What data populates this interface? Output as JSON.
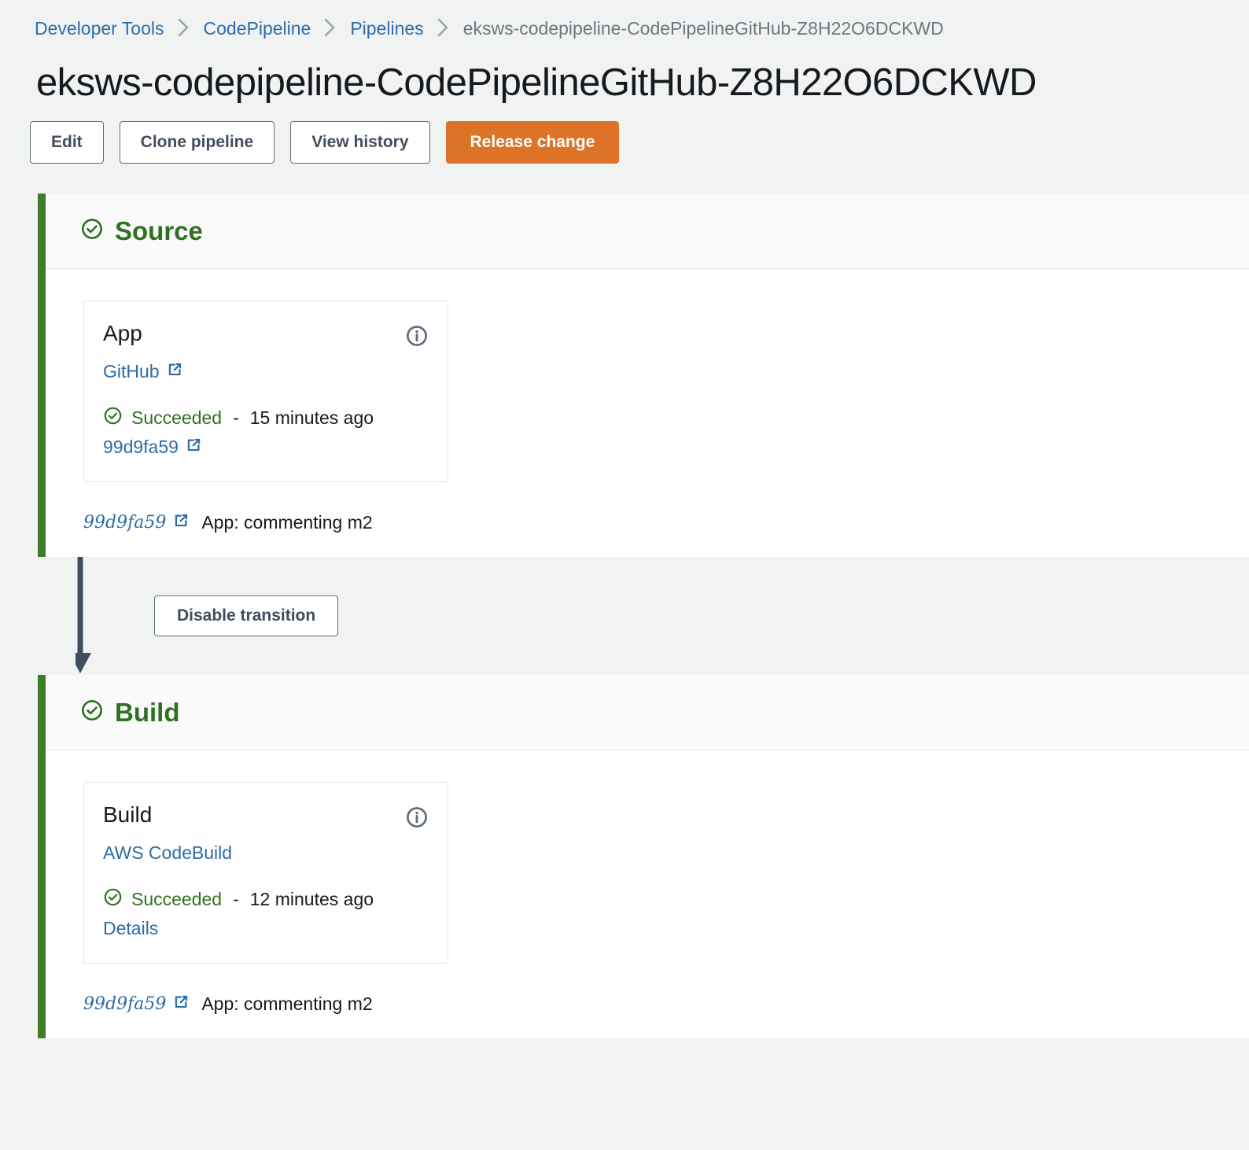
{
  "breadcrumb": {
    "items": [
      {
        "label": "Developer Tools",
        "type": "link"
      },
      {
        "label": "CodePipeline",
        "type": "link"
      },
      {
        "label": "Pipelines",
        "type": "link"
      },
      {
        "label": "eksws-codepipeline-CodePipelineGitHub-Z8H22O6DCKWD",
        "type": "current"
      }
    ],
    "separator_icon": "chevron-right-icon"
  },
  "page": {
    "title": "eksws-codepipeline-CodePipelineGitHub-Z8H22O6DCKWD"
  },
  "toolbar": {
    "edit_label": "Edit",
    "clone_label": "Clone pipeline",
    "history_label": "View history",
    "release_label": "Release change",
    "primary_color": "#dd7326"
  },
  "colors": {
    "success_green": "#2f7122",
    "stage_bar_green": "#3e7d28",
    "link_blue": "#2d6ca8",
    "slate": "#5f6b7a",
    "page_bg": "#f1f3f3"
  },
  "stages": [
    {
      "name": "Source",
      "status_icon": "check-circle-icon",
      "action": {
        "name": "App",
        "info_icon": "info-icon",
        "provider": "GitHub",
        "provider_external_icon": "external-link-icon",
        "provider_has_external_icon": true,
        "status": "Succeeded",
        "status_icon": "check-circle-icon",
        "status_separator": "-",
        "status_time": "15 minutes ago",
        "link_label": "99d9fa59",
        "link_external_icon": "external-link-icon",
        "link_has_external_icon": true
      },
      "revision": {
        "hash": "99d9fa59",
        "external_icon": "external-link-icon",
        "message": "App: commenting m2"
      }
    },
    {
      "name": "Build",
      "status_icon": "check-circle-icon",
      "action": {
        "name": "Build",
        "info_icon": "info-icon",
        "provider": "AWS CodeBuild",
        "provider_external_icon": "",
        "provider_has_external_icon": false,
        "status": "Succeeded",
        "status_icon": "check-circle-icon",
        "status_separator": "-",
        "status_time": "12 minutes ago",
        "link_label": "Details",
        "link_external_icon": "",
        "link_has_external_icon": false
      },
      "revision": {
        "hash": "99d9fa59",
        "external_icon": "external-link-icon",
        "message": "App: commenting m2"
      }
    }
  ],
  "transition": {
    "disable_label": "Disable transition",
    "arrow_icon": "down-arrow-icon"
  }
}
